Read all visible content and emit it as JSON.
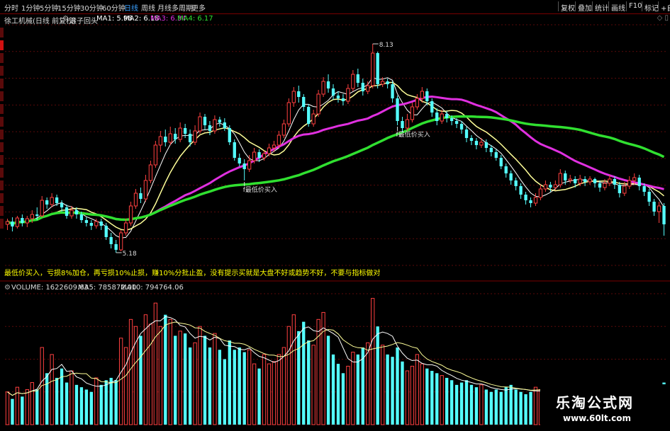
{
  "toolbar": {
    "periods": [
      "分时",
      "1分钟",
      "5分钟",
      "15分钟",
      "30分钟",
      "60分钟",
      "日线",
      "周线",
      "月线",
      "多周期",
      "更多"
    ],
    "active_period": "日线",
    "right_buttons": [
      "复权",
      "叠加",
      "统计",
      "画线",
      "F10",
      "标记",
      "+自"
    ]
  },
  "stock": {
    "name": "徐工机械(日线 前复权)",
    "indicator": "滚子回头",
    "ma": [
      {
        "label": "MA1: 5.96",
        "color": "#ffffff"
      },
      {
        "label": "MA2: 6.18",
        "color": "#ffffff"
      },
      {
        "label": "MA3: 6.34",
        "color": "#e030e0"
      },
      {
        "label": "MA4: 6.17",
        "color": "#30e030"
      }
    ]
  },
  "note": "最低价买入，亏损8%加仓，再亏损10%止损，赚10%分批止盈，没有提示买就是大盘不好或趋势不好，不要与指标做对",
  "volume_info": {
    "volume": "VOLUME: 1622609.63",
    "ma5": "MA5: 785872.00",
    "ma10": "MA10: 794764.06"
  },
  "watermark": {
    "title": "乐淘公式网",
    "url": "www.60lt.com"
  },
  "colors": {
    "up": "#ff4040",
    "down": "#54ffff",
    "ma_fast": "#ffffff",
    "ma_slow": "#ffff99",
    "ma3": "#e030e0",
    "ma4": "#30e030",
    "note": "#ffff00"
  },
  "chart_data": {
    "type": "candlestick",
    "high_label": "8.13",
    "low_label": "5.18",
    "price_range": [
      5.0,
      8.4
    ],
    "buy_signals": [
      {
        "index": 48,
        "label": "最低价买入"
      },
      {
        "index": 79,
        "label": "最低价买入"
      }
    ],
    "candles": [
      [
        5.58,
        5.62,
        5.5,
        5.66
      ],
      [
        5.62,
        5.55,
        5.48,
        5.68
      ],
      [
        5.55,
        5.67,
        5.52,
        5.7
      ],
      [
        5.67,
        5.6,
        5.55,
        5.72
      ],
      [
        5.6,
        5.66,
        5.54,
        5.7
      ],
      [
        5.66,
        5.72,
        5.6,
        5.78
      ],
      [
        5.72,
        5.7,
        5.64,
        5.82
      ],
      [
        5.7,
        5.92,
        5.68,
        5.98
      ],
      [
        5.92,
        5.86,
        5.8,
        5.96
      ],
      [
        5.86,
        5.96,
        5.82,
        6.02
      ],
      [
        5.96,
        5.88,
        5.84,
        6.0
      ],
      [
        5.88,
        5.82,
        5.76,
        5.92
      ],
      [
        5.82,
        5.7,
        5.66,
        5.86
      ],
      [
        5.7,
        5.78,
        5.66,
        5.84
      ],
      [
        5.78,
        5.72,
        5.66,
        5.82
      ],
      [
        5.72,
        5.64,
        5.6,
        5.76
      ],
      [
        5.64,
        5.6,
        5.55,
        5.68
      ],
      [
        5.6,
        5.56,
        5.5,
        5.64
      ],
      [
        5.56,
        5.62,
        5.52,
        5.66
      ],
      [
        5.62,
        5.56,
        5.5,
        5.66
      ],
      [
        5.56,
        5.4,
        5.36,
        5.6
      ],
      [
        5.4,
        5.3,
        5.24,
        5.46
      ],
      [
        5.3,
        5.22,
        5.18,
        5.36
      ],
      [
        5.22,
        5.46,
        5.2,
        5.5
      ],
      [
        5.46,
        5.6,
        5.42,
        5.66
      ],
      [
        5.6,
        5.84,
        5.56,
        5.9
      ],
      [
        5.84,
        6.02,
        5.8,
        6.08
      ],
      [
        6.02,
        5.94,
        5.88,
        6.1
      ],
      [
        5.94,
        6.2,
        5.9,
        6.28
      ],
      [
        6.2,
        6.42,
        6.16,
        6.48
      ],
      [
        6.42,
        6.7,
        6.38,
        6.76
      ],
      [
        6.7,
        6.82,
        6.6,
        6.9
      ],
      [
        6.82,
        6.74,
        6.68,
        6.92
      ],
      [
        6.74,
        6.86,
        6.7,
        6.96
      ],
      [
        6.86,
        6.78,
        6.72,
        6.94
      ],
      [
        6.78,
        6.94,
        6.74,
        7.02
      ],
      [
        6.94,
        6.86,
        6.8,
        7.0
      ],
      [
        6.86,
        6.74,
        6.68,
        6.92
      ],
      [
        6.74,
        6.9,
        6.7,
        6.98
      ],
      [
        6.9,
        7.1,
        6.86,
        7.16
      ],
      [
        7.1,
        6.98,
        6.92,
        7.14
      ],
      [
        6.98,
        6.9,
        6.84,
        7.04
      ],
      [
        6.9,
        7.06,
        6.86,
        7.12
      ],
      [
        7.06,
        7.02,
        6.96,
        7.1
      ],
      [
        7.02,
        6.94,
        6.9,
        7.08
      ],
      [
        6.94,
        6.74,
        6.7,
        6.98
      ],
      [
        6.74,
        6.52,
        6.48,
        6.78
      ],
      [
        6.52,
        6.44,
        6.4,
        6.58
      ],
      [
        6.44,
        6.36,
        6.2,
        6.5
      ],
      [
        6.36,
        6.48,
        6.32,
        6.56
      ],
      [
        6.48,
        6.6,
        6.44,
        6.66
      ],
      [
        6.6,
        6.52,
        6.46,
        6.64
      ],
      [
        6.52,
        6.58,
        6.48,
        6.62
      ],
      [
        6.58,
        6.66,
        6.54,
        6.72
      ],
      [
        6.66,
        6.7,
        6.6,
        6.76
      ],
      [
        6.7,
        6.84,
        6.66,
        6.9
      ],
      [
        6.84,
        7.0,
        6.8,
        7.06
      ],
      [
        7.0,
        7.3,
        6.96,
        7.36
      ],
      [
        7.3,
        7.46,
        7.24,
        7.52
      ],
      [
        7.46,
        7.38,
        7.3,
        7.54
      ],
      [
        7.38,
        7.24,
        7.18,
        7.42
      ],
      [
        7.24,
        7.0,
        6.96,
        7.28
      ],
      [
        7.0,
        7.14,
        6.96,
        7.2
      ],
      [
        7.14,
        7.42,
        7.1,
        7.48
      ],
      [
        7.42,
        7.6,
        7.38,
        7.66
      ],
      [
        7.6,
        7.5,
        7.44,
        7.7
      ],
      [
        7.5,
        7.4,
        7.34,
        7.56
      ],
      [
        7.4,
        7.36,
        7.3,
        7.46
      ],
      [
        7.36,
        7.32,
        7.26,
        7.42
      ],
      [
        7.32,
        7.5,
        7.28,
        7.56
      ],
      [
        7.5,
        7.7,
        7.46,
        7.76
      ],
      [
        7.7,
        7.58,
        7.52,
        7.78
      ],
      [
        7.58,
        7.46,
        7.4,
        7.64
      ],
      [
        7.46,
        7.54,
        7.42,
        7.6
      ],
      [
        7.54,
        8.0,
        7.5,
        8.13
      ],
      [
        8.0,
        7.56,
        7.5,
        8.02
      ],
      [
        7.56,
        7.6,
        7.52,
        7.66
      ],
      [
        7.6,
        7.56,
        7.5,
        7.64
      ],
      [
        7.56,
        7.36,
        7.3,
        7.6
      ],
      [
        7.36,
        7.04,
        6.98,
        7.4
      ],
      [
        7.04,
        6.94,
        6.88,
        7.1
      ],
      [
        6.94,
        7.06,
        6.9,
        7.14
      ],
      [
        7.06,
        7.24,
        7.02,
        7.3
      ],
      [
        7.24,
        7.36,
        7.2,
        7.42
      ],
      [
        7.36,
        7.46,
        7.3,
        7.52
      ],
      [
        7.46,
        7.32,
        7.26,
        7.5
      ],
      [
        7.32,
        7.16,
        7.1,
        7.36
      ],
      [
        7.16,
        7.04,
        6.98,
        7.22
      ],
      [
        7.04,
        7.14,
        7.0,
        7.2
      ],
      [
        7.14,
        7.08,
        7.02,
        7.18
      ],
      [
        7.08,
        7.04,
        6.98,
        7.12
      ],
      [
        7.04,
        7.0,
        6.94,
        7.08
      ],
      [
        7.0,
        6.92,
        6.86,
        7.04
      ],
      [
        6.92,
        6.8,
        6.74,
        6.96
      ],
      [
        6.8,
        6.76,
        6.7,
        6.84
      ],
      [
        6.76,
        6.7,
        6.64,
        6.8
      ],
      [
        6.7,
        6.74,
        6.66,
        6.8
      ],
      [
        6.74,
        6.66,
        6.6,
        6.78
      ],
      [
        6.66,
        6.6,
        6.54,
        6.7
      ],
      [
        6.6,
        6.52,
        6.48,
        6.64
      ],
      [
        6.52,
        6.4,
        6.36,
        6.56
      ],
      [
        6.4,
        6.3,
        6.24,
        6.44
      ],
      [
        6.3,
        6.2,
        6.14,
        6.34
      ],
      [
        6.2,
        6.12,
        6.06,
        6.24
      ],
      [
        6.12,
        6.0,
        5.94,
        6.16
      ],
      [
        6.0,
        5.92,
        5.86,
        6.04
      ],
      [
        5.92,
        5.88,
        5.82,
        5.96
      ],
      [
        5.88,
        5.96,
        5.84,
        6.02
      ],
      [
        5.96,
        6.08,
        5.92,
        6.14
      ],
      [
        6.08,
        6.14,
        6.04,
        6.2
      ],
      [
        6.14,
        6.1,
        6.04,
        6.18
      ],
      [
        6.1,
        6.14,
        6.06,
        6.2
      ],
      [
        6.14,
        6.3,
        6.1,
        6.36
      ],
      [
        6.3,
        6.2,
        6.14,
        6.34
      ],
      [
        6.2,
        6.22,
        6.16,
        6.28
      ],
      [
        6.22,
        6.16,
        6.1,
        6.26
      ],
      [
        6.16,
        6.22,
        6.12,
        6.28
      ],
      [
        6.22,
        6.18,
        6.12,
        6.26
      ],
      [
        6.18,
        6.22,
        6.14,
        6.26
      ],
      [
        6.22,
        6.16,
        6.1,
        6.24
      ],
      [
        6.16,
        6.1,
        6.04,
        6.2
      ],
      [
        6.1,
        6.16,
        6.06,
        6.22
      ],
      [
        6.16,
        6.22,
        6.12,
        6.28
      ],
      [
        6.22,
        6.14,
        6.08,
        6.26
      ],
      [
        6.14,
        6.02,
        5.96,
        6.18
      ],
      [
        6.02,
        6.12,
        5.98,
        6.18
      ],
      [
        6.12,
        6.2,
        6.08,
        6.26
      ],
      [
        6.2,
        6.24,
        6.14,
        6.3
      ],
      [
        6.24,
        6.12,
        6.06,
        6.28
      ],
      [
        6.12,
        6.04,
        5.98,
        6.16
      ],
      [
        6.04,
        5.9,
        5.84,
        6.08
      ],
      [
        5.9,
        5.76,
        5.7,
        5.94
      ],
      [
        5.76,
        5.84,
        5.6,
        5.9
      ],
      [
        5.84,
        5.58,
        5.42,
        5.88
      ]
    ],
    "volumes": [
      140,
      110,
      160,
      120,
      150,
      180,
      150,
      330,
      220,
      300,
      200,
      240,
      180,
      230,
      170,
      160,
      150,
      140,
      200,
      170,
      190,
      200,
      190,
      370,
      330,
      450,
      420,
      380,
      470,
      430,
      520,
      420,
      470,
      450,
      380,
      400,
      390,
      330,
      350,
      420,
      380,
      330,
      390,
      320,
      280,
      360,
      320,
      330,
      310,
      320,
      260,
      240,
      300,
      260,
      270,
      300,
      330,
      420,
      470,
      400,
      440,
      360,
      340,
      450,
      480,
      380,
      300,
      260,
      220,
      250,
      310,
      300,
      330,
      350,
      540,
      420,
      340,
      300,
      290,
      330,
      270,
      230,
      250,
      300,
      260,
      240,
      230,
      220,
      210,
      200,
      190,
      170,
      180,
      190,
      170,
      160,
      170,
      150,
      140,
      150,
      140,
      160,
      170,
      150,
      140,
      130,
      140,
      160,
      150,
      140,
      130,
      140,
      150,
      130,
      140,
      130,
      120,
      130,
      120,
      130,
      120,
      130,
      140,
      120,
      130,
      110,
      120,
      130,
      120,
      140,
      150,
      160,
      170,
      180
    ],
    "vol_range": [
      0,
      560
    ],
    "series": [
      {
        "name": "MA1",
        "color": "#ffffff"
      },
      {
        "name": "MA2",
        "color": "#ffff99"
      },
      {
        "name": "MA3",
        "color": "#e030e0"
      },
      {
        "name": "MA4",
        "color": "#30e030"
      }
    ]
  }
}
